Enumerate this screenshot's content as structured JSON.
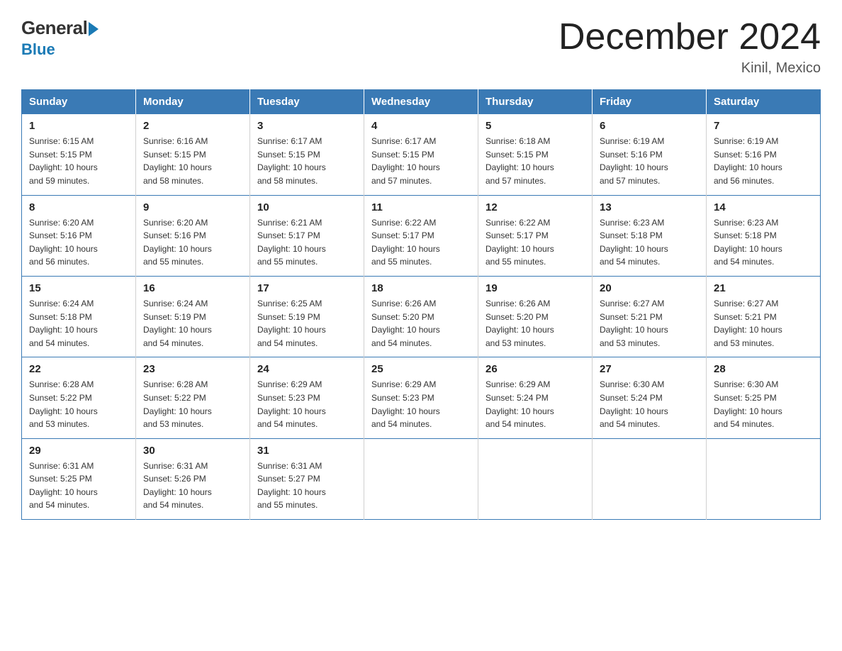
{
  "header": {
    "logo_general": "General",
    "logo_blue": "Blue",
    "title": "December 2024",
    "location": "Kinil, Mexico"
  },
  "calendar": {
    "days_of_week": [
      "Sunday",
      "Monday",
      "Tuesday",
      "Wednesday",
      "Thursday",
      "Friday",
      "Saturday"
    ],
    "weeks": [
      [
        {
          "day": "1",
          "info": "Sunrise: 6:15 AM\nSunset: 5:15 PM\nDaylight: 10 hours\nand 59 minutes."
        },
        {
          "day": "2",
          "info": "Sunrise: 6:16 AM\nSunset: 5:15 PM\nDaylight: 10 hours\nand 58 minutes."
        },
        {
          "day": "3",
          "info": "Sunrise: 6:17 AM\nSunset: 5:15 PM\nDaylight: 10 hours\nand 58 minutes."
        },
        {
          "day": "4",
          "info": "Sunrise: 6:17 AM\nSunset: 5:15 PM\nDaylight: 10 hours\nand 57 minutes."
        },
        {
          "day": "5",
          "info": "Sunrise: 6:18 AM\nSunset: 5:15 PM\nDaylight: 10 hours\nand 57 minutes."
        },
        {
          "day": "6",
          "info": "Sunrise: 6:19 AM\nSunset: 5:16 PM\nDaylight: 10 hours\nand 57 minutes."
        },
        {
          "day": "7",
          "info": "Sunrise: 6:19 AM\nSunset: 5:16 PM\nDaylight: 10 hours\nand 56 minutes."
        }
      ],
      [
        {
          "day": "8",
          "info": "Sunrise: 6:20 AM\nSunset: 5:16 PM\nDaylight: 10 hours\nand 56 minutes."
        },
        {
          "day": "9",
          "info": "Sunrise: 6:20 AM\nSunset: 5:16 PM\nDaylight: 10 hours\nand 55 minutes."
        },
        {
          "day": "10",
          "info": "Sunrise: 6:21 AM\nSunset: 5:17 PM\nDaylight: 10 hours\nand 55 minutes."
        },
        {
          "day": "11",
          "info": "Sunrise: 6:22 AM\nSunset: 5:17 PM\nDaylight: 10 hours\nand 55 minutes."
        },
        {
          "day": "12",
          "info": "Sunrise: 6:22 AM\nSunset: 5:17 PM\nDaylight: 10 hours\nand 55 minutes."
        },
        {
          "day": "13",
          "info": "Sunrise: 6:23 AM\nSunset: 5:18 PM\nDaylight: 10 hours\nand 54 minutes."
        },
        {
          "day": "14",
          "info": "Sunrise: 6:23 AM\nSunset: 5:18 PM\nDaylight: 10 hours\nand 54 minutes."
        }
      ],
      [
        {
          "day": "15",
          "info": "Sunrise: 6:24 AM\nSunset: 5:18 PM\nDaylight: 10 hours\nand 54 minutes."
        },
        {
          "day": "16",
          "info": "Sunrise: 6:24 AM\nSunset: 5:19 PM\nDaylight: 10 hours\nand 54 minutes."
        },
        {
          "day": "17",
          "info": "Sunrise: 6:25 AM\nSunset: 5:19 PM\nDaylight: 10 hours\nand 54 minutes."
        },
        {
          "day": "18",
          "info": "Sunrise: 6:26 AM\nSunset: 5:20 PM\nDaylight: 10 hours\nand 54 minutes."
        },
        {
          "day": "19",
          "info": "Sunrise: 6:26 AM\nSunset: 5:20 PM\nDaylight: 10 hours\nand 53 minutes."
        },
        {
          "day": "20",
          "info": "Sunrise: 6:27 AM\nSunset: 5:21 PM\nDaylight: 10 hours\nand 53 minutes."
        },
        {
          "day": "21",
          "info": "Sunrise: 6:27 AM\nSunset: 5:21 PM\nDaylight: 10 hours\nand 53 minutes."
        }
      ],
      [
        {
          "day": "22",
          "info": "Sunrise: 6:28 AM\nSunset: 5:22 PM\nDaylight: 10 hours\nand 53 minutes."
        },
        {
          "day": "23",
          "info": "Sunrise: 6:28 AM\nSunset: 5:22 PM\nDaylight: 10 hours\nand 53 minutes."
        },
        {
          "day": "24",
          "info": "Sunrise: 6:29 AM\nSunset: 5:23 PM\nDaylight: 10 hours\nand 54 minutes."
        },
        {
          "day": "25",
          "info": "Sunrise: 6:29 AM\nSunset: 5:23 PM\nDaylight: 10 hours\nand 54 minutes."
        },
        {
          "day": "26",
          "info": "Sunrise: 6:29 AM\nSunset: 5:24 PM\nDaylight: 10 hours\nand 54 minutes."
        },
        {
          "day": "27",
          "info": "Sunrise: 6:30 AM\nSunset: 5:24 PM\nDaylight: 10 hours\nand 54 minutes."
        },
        {
          "day": "28",
          "info": "Sunrise: 6:30 AM\nSunset: 5:25 PM\nDaylight: 10 hours\nand 54 minutes."
        }
      ],
      [
        {
          "day": "29",
          "info": "Sunrise: 6:31 AM\nSunset: 5:25 PM\nDaylight: 10 hours\nand 54 minutes."
        },
        {
          "day": "30",
          "info": "Sunrise: 6:31 AM\nSunset: 5:26 PM\nDaylight: 10 hours\nand 54 minutes."
        },
        {
          "day": "31",
          "info": "Sunrise: 6:31 AM\nSunset: 5:27 PM\nDaylight: 10 hours\nand 55 minutes."
        },
        {
          "day": "",
          "info": ""
        },
        {
          "day": "",
          "info": ""
        },
        {
          "day": "",
          "info": ""
        },
        {
          "day": "",
          "info": ""
        }
      ]
    ]
  }
}
